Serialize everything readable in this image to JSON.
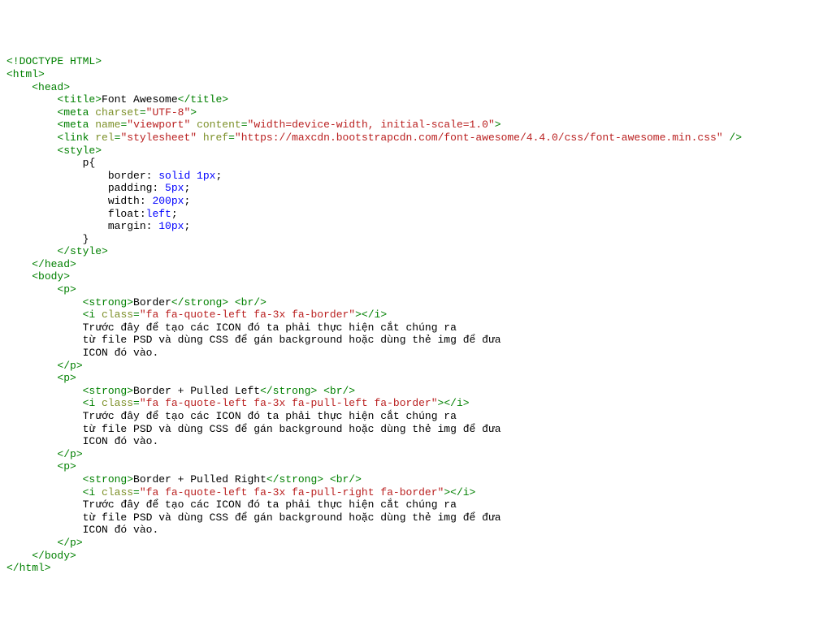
{
  "l1": "<!DOCTYPE HTML>",
  "l2_open": "<html>",
  "l3_open": "<head>",
  "l4_title_open": "<title>",
  "l4_title_text": "Font Awesome",
  "l4_title_close": "</title>",
  "l5_meta_open": "<meta",
  "l5_attr_charset": " charset",
  "l5_eq": "=",
  "l5_val_charset": "\"UTF-8\"",
  "l5_close": ">",
  "l6_meta_open": "<meta",
  "l6_attr_name": " name",
  "l6_val_name": "\"viewport\"",
  "l6_attr_content": " content",
  "l6_val_content": "\"width=device-width, initial-scale=1.0\"",
  "l6_close": ">",
  "l7_link_open": "<link",
  "l7_attr_rel": " rel",
  "l7_val_rel": "\"stylesheet\"",
  "l7_attr_href": " href",
  "l7_val_href": "\"https://maxcdn.bootstrapcdn.com/font-awesome/4.4.0/css/font-awesome.min.css\"",
  "l7_close": " />",
  "l8_style_open": "<style>",
  "css_sel": "p",
  "css_brace_open": "{",
  "css_border": "border: ",
  "css_border_val": "solid 1px",
  "css_padding": "padding: ",
  "css_padding_val": "5px",
  "css_width": "width: ",
  "css_width_val": "200px",
  "css_float": "float:",
  "css_float_val": "left",
  "css_margin": "margin: ",
  "css_margin_val": "10px",
  "css_brace_close": "}",
  "l_style_close": "</style>",
  "l_head_close": "</head>",
  "l_body_open": "<body>",
  "p_open": "<p>",
  "p_close": "</p>",
  "strong_open": "<strong>",
  "strong_close": "</strong>",
  "br": " <br/>",
  "i_open": "<i",
  "i_attr_class": " class",
  "i_close_tag": ">",
  "i_end": "</i>",
  "semicolon": ";",
  "sec1_title": "Border",
  "sec1_class": "\"fa fa-quote-left fa-3x fa-border\"",
  "sec2_title": "Border + Pulled Left",
  "sec2_class": "\"fa fa-quote-left fa-3x fa-pull-left fa-border\"",
  "sec3_title": "Border + Pulled Right",
  "sec3_class": "\"fa fa-quote-left fa-3x fa-pull-right fa-border\"",
  "para_line1": "Trước đây để tạo các ICON đó ta phải thực hiện cắt chúng ra",
  "para_line2": "từ file PSD và dùng CSS để gán background hoặc dùng thẻ img để đưa",
  "para_line3": "ICON đó vào.",
  "l_body_close": "</body>",
  "l_html_close": "</html>"
}
